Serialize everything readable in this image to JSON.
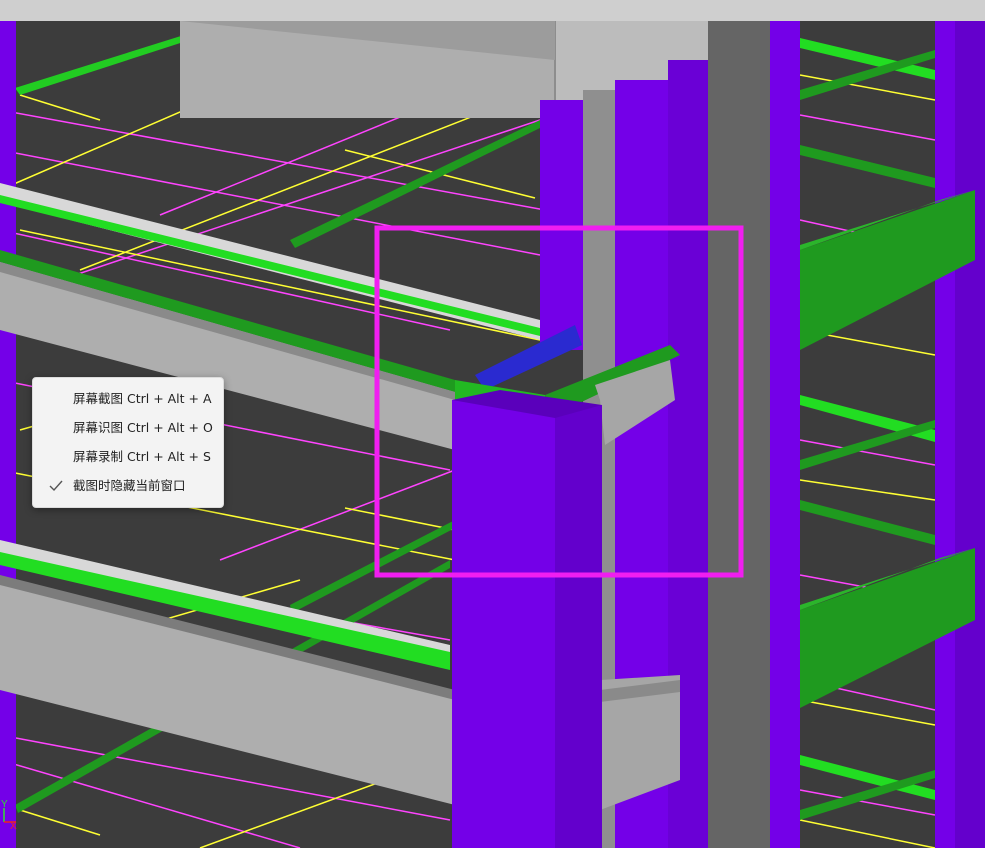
{
  "context_menu": {
    "items": [
      {
        "label": "屏幕截图 Ctrl + Alt + A",
        "checked": false
      },
      {
        "label": "屏幕识图 Ctrl + Alt + O",
        "checked": false
      },
      {
        "label": "屏幕录制 Ctrl + Alt + S",
        "checked": false
      },
      {
        "label": "截图时隐藏当前窗口",
        "checked": true
      }
    ]
  },
  "axis_triad": {
    "y_label": "Y",
    "x_label": "X"
  },
  "colors": {
    "background": "#3c3c3c",
    "column_purple": "#7400e8",
    "slab_gray": "#aeaeae",
    "beam_green": "#1f9a1f",
    "rebar_green": "#22dd22",
    "grid_magenta": "#ff44ff",
    "grid_yellow": "#ffff33",
    "connector_blue": "#2a2ad0",
    "selection_box": "#f01ef0"
  },
  "icons": {
    "check": "checkmark-icon"
  }
}
